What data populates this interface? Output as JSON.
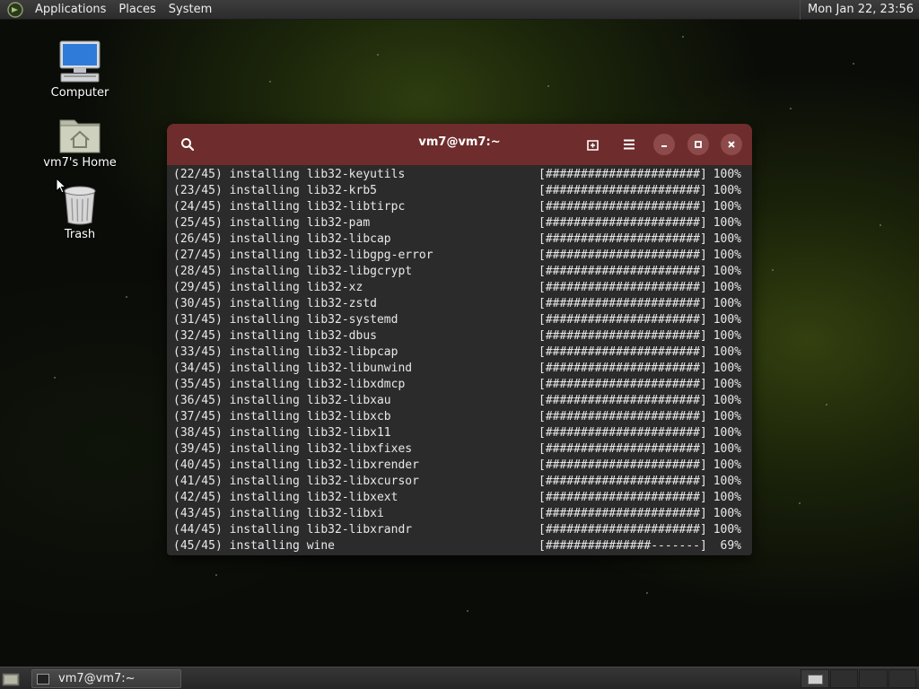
{
  "top_panel": {
    "menus": [
      "Applications",
      "Places",
      "System"
    ],
    "clock": "Mon Jan 22, 23:56"
  },
  "desktop_icons": [
    {
      "label": "Computer",
      "icon": "computer-icon"
    },
    {
      "label": "vm7's Home",
      "icon": "home-folder-icon"
    },
    {
      "label": "Trash",
      "icon": "trash-icon"
    }
  ],
  "terminal": {
    "title": "vm7@vm7:~",
    "lines": [
      {
        "left": "(22/45) installing lib32-keyutils",
        "bar": "[######################]",
        "pct": "100%"
      },
      {
        "left": "(23/45) installing lib32-krb5",
        "bar": "[######################]",
        "pct": "100%"
      },
      {
        "left": "(24/45) installing lib32-libtirpc",
        "bar": "[######################]",
        "pct": "100%"
      },
      {
        "left": "(25/45) installing lib32-pam",
        "bar": "[######################]",
        "pct": "100%"
      },
      {
        "left": "(26/45) installing lib32-libcap",
        "bar": "[######################]",
        "pct": "100%"
      },
      {
        "left": "(27/45) installing lib32-libgpg-error",
        "bar": "[######################]",
        "pct": "100%"
      },
      {
        "left": "(28/45) installing lib32-libgcrypt",
        "bar": "[######################]",
        "pct": "100%"
      },
      {
        "left": "(29/45) installing lib32-xz",
        "bar": "[######################]",
        "pct": "100%"
      },
      {
        "left": "(30/45) installing lib32-zstd",
        "bar": "[######################]",
        "pct": "100%"
      },
      {
        "left": "(31/45) installing lib32-systemd",
        "bar": "[######################]",
        "pct": "100%"
      },
      {
        "left": "(32/45) installing lib32-dbus",
        "bar": "[######################]",
        "pct": "100%"
      },
      {
        "left": "(33/45) installing lib32-libpcap",
        "bar": "[######################]",
        "pct": "100%"
      },
      {
        "left": "(34/45) installing lib32-libunwind",
        "bar": "[######################]",
        "pct": "100%"
      },
      {
        "left": "(35/45) installing lib32-libxdmcp",
        "bar": "[######################]",
        "pct": "100%"
      },
      {
        "left": "(36/45) installing lib32-libxau",
        "bar": "[######################]",
        "pct": "100%"
      },
      {
        "left": "(37/45) installing lib32-libxcb",
        "bar": "[######################]",
        "pct": "100%"
      },
      {
        "left": "(38/45) installing lib32-libx11",
        "bar": "[######################]",
        "pct": "100%"
      },
      {
        "left": "(39/45) installing lib32-libxfixes",
        "bar": "[######################]",
        "pct": "100%"
      },
      {
        "left": "(40/45) installing lib32-libxrender",
        "bar": "[######################]",
        "pct": "100%"
      },
      {
        "left": "(41/45) installing lib32-libxcursor",
        "bar": "[######################]",
        "pct": "100%"
      },
      {
        "left": "(42/45) installing lib32-libxext",
        "bar": "[######################]",
        "pct": "100%"
      },
      {
        "left": "(43/45) installing lib32-libxi",
        "bar": "[######################]",
        "pct": "100%"
      },
      {
        "left": "(44/45) installing lib32-libxrandr",
        "bar": "[######################]",
        "pct": "100%"
      },
      {
        "left": "(45/45) installing wine",
        "bar": "[###############-------]",
        "pct": "69%"
      }
    ]
  },
  "taskbar": {
    "task_label": "vm7@vm7:~",
    "workspace_count": 4,
    "active_workspace": 1
  },
  "colors": {
    "titlebar": "#6e2c2c",
    "terminal_bg": "#2b2b2b",
    "terminal_fg": "#e8e8e8"
  }
}
